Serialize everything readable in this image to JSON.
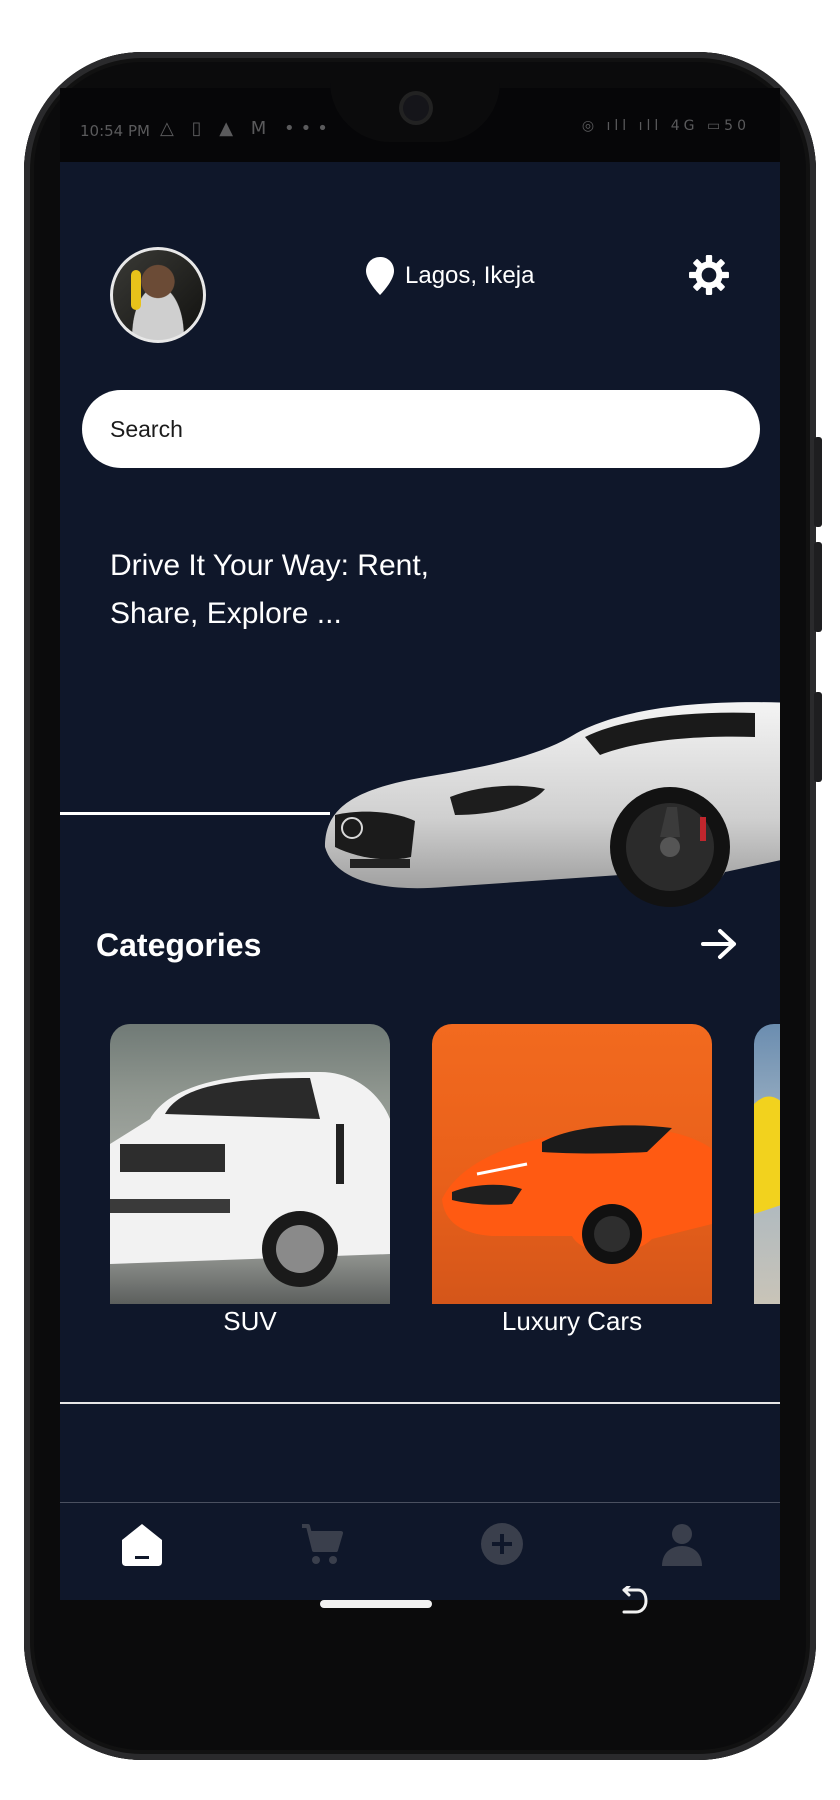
{
  "status_bar": {
    "time": "10:54 PM",
    "left_icons": "△ ▯ ▲ M •••",
    "right_icons": "◎ ıll ıll 4G ▭50"
  },
  "header": {
    "avatar": "user-avatar",
    "location": "Lagos, Ikeja",
    "location_icon": "map-pin-icon",
    "settings_icon": "gear-icon"
  },
  "search": {
    "placeholder": "Search"
  },
  "hero": {
    "tagline": "Drive It Your Way: Rent, Share, Explore ..."
  },
  "categories": {
    "title": "Categories",
    "arrow_icon": "arrow-right-icon",
    "items": [
      {
        "label": "SUV",
        "image": "white-suv-photo"
      },
      {
        "label": "Luxury Cars",
        "image": "orange-sports-car-photo"
      },
      {
        "label": "",
        "image": "yellow-car-photo"
      }
    ]
  },
  "bottom_nav": {
    "items": [
      {
        "icon": "home-icon",
        "active": true
      },
      {
        "icon": "cart-icon",
        "active": false
      },
      {
        "icon": "add-circle-icon",
        "active": false
      },
      {
        "icon": "profile-icon",
        "active": false
      }
    ]
  },
  "colors": {
    "background": "#0f172a",
    "text": "#ffffff",
    "nav_inactive": "#3a3f4c"
  }
}
